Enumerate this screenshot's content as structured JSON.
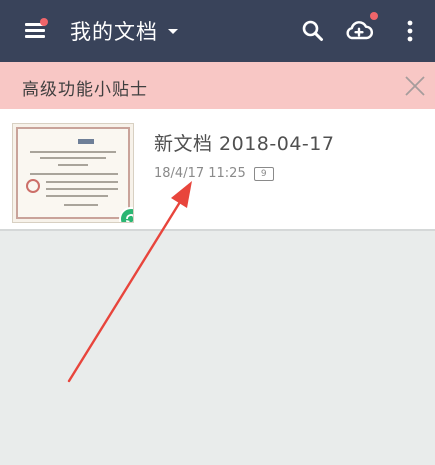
{
  "app_bar": {
    "title": "我的文档",
    "menu_icon": "hamburger-menu-icon",
    "search_icon": "search-icon",
    "cloud_icon": "cloud-upload-icon",
    "more_icon": "more-vert-icon",
    "notification_color": "#f0656a",
    "background_color": "#39435a"
  },
  "tips_banner": {
    "text": "高级功能小贴士",
    "close_icon": "close-icon",
    "background_color": "#f8c7c5"
  },
  "documents": [
    {
      "title": "新文档 2018-04-17",
      "date": "18/4/17 11:25",
      "page_count": "9",
      "thumbnail": "certificate-thumbnail",
      "status_icon": "sync-icon",
      "status_color": "#2bb673"
    }
  ],
  "annotation": {
    "icon": "red-arrow-icon",
    "color": "#e8453c"
  }
}
